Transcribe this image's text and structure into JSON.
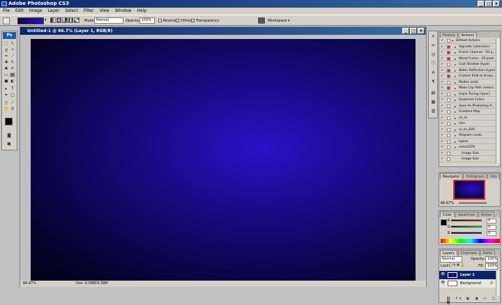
{
  "app": {
    "title": "Adobe Photoshop CS3"
  },
  "menu": [
    "File",
    "Edit",
    "Image",
    "Layer",
    "Select",
    "Filter",
    "View",
    "Window",
    "Help"
  ],
  "options": {
    "mode_label": "Mode:",
    "mode_value": "Normal",
    "opacity_label": "Opacity:",
    "opacity_value": "100%",
    "reverse_label": "Reverse",
    "dither_label": "Dither",
    "transparency_label": "Transparency",
    "workspace_label": "Workspace"
  },
  "toolbox": {
    "logo": "Ps"
  },
  "document": {
    "title": "Untitled-1 @ 66.7% (Layer 1, RGB/8)",
    "zoom": "66.67%",
    "doc_info": "Doc: 6.59M/4.39M"
  },
  "actions_panel": {
    "tabs": [
      "History",
      "Actions"
    ],
    "items": [
      {
        "label": "Default Actions",
        "type": "set",
        "red": false,
        "level": 0
      },
      {
        "label": "Vignette (selection)",
        "type": "action",
        "red": true,
        "level": 1
      },
      {
        "label": "Frame Channel - 50 p...",
        "type": "action",
        "red": true,
        "level": 1
      },
      {
        "label": "Wood Frame - 50 pixel",
        "type": "action",
        "red": true,
        "level": 1
      },
      {
        "label": "Cast Shadow (type)",
        "type": "action",
        "red": false,
        "level": 1
      },
      {
        "label": "Water Reflection (type)",
        "type": "action",
        "red": true,
        "level": 1
      },
      {
        "label": "Custom RGB to Grays...",
        "type": "action",
        "red": true,
        "level": 1
      },
      {
        "label": "Molten Lead",
        "type": "action",
        "red": false,
        "level": 1
      },
      {
        "label": "Make Clip Path (select...",
        "type": "action",
        "red": true,
        "level": 1
      },
      {
        "label": "Sepia Toning (layer)",
        "type": "action",
        "red": false,
        "level": 1
      },
      {
        "label": "Quadrant Colors",
        "type": "action",
        "red": false,
        "level": 1
      },
      {
        "label": "Save As Photoshop P...",
        "type": "action",
        "red": false,
        "level": 1
      },
      {
        "label": "Gradient Map",
        "type": "action",
        "red": false,
        "level": 1
      },
      {
        "label": "sh_re",
        "type": "action",
        "red": false,
        "level": 1
      },
      {
        "label": "skin",
        "type": "action",
        "red": false,
        "level": 1
      },
      {
        "label": "re_sh_640",
        "type": "action",
        "red": false,
        "level": 1
      },
      {
        "label": "filogram rundo",
        "type": "action",
        "red": false,
        "level": 1
      },
      {
        "label": "hgaas",
        "type": "action",
        "red": false,
        "level": 1
      },
      {
        "label": "resize25%",
        "type": "action_open",
        "red": false,
        "level": 1
      },
      {
        "label": "Image Size",
        "type": "step",
        "red": false,
        "level": 2
      },
      {
        "label": "Image Size",
        "type": "step",
        "red": false,
        "level": 2
      }
    ]
  },
  "navigator_panel": {
    "tabs": [
      "Navigator",
      "Histogram",
      "Info"
    ],
    "zoom": "66.67%"
  },
  "color_panel": {
    "tabs": [
      "Color",
      "Swatches",
      "Styles"
    ],
    "channels": [
      {
        "label": "R",
        "value": "0"
      },
      {
        "label": "G",
        "value": "0"
      },
      {
        "label": "B",
        "value": "0"
      }
    ]
  },
  "layers_panel": {
    "tabs": [
      "Layers",
      "Channels",
      "Paths"
    ],
    "blend_mode": "Normal",
    "opacity_label": "Opacity:",
    "opacity_value": "100%",
    "lock_label": "Lock:",
    "fill_label": "Fill:",
    "fill_value": "100%",
    "layers": [
      {
        "name": "Layer 1",
        "selected": true
      },
      {
        "name": "Background",
        "selected": false
      }
    ]
  },
  "colors": {
    "accent": "#0a246a",
    "canvas_center": "#2d10c8",
    "canvas_edge": "#03011a",
    "selection": "#0a246a"
  }
}
